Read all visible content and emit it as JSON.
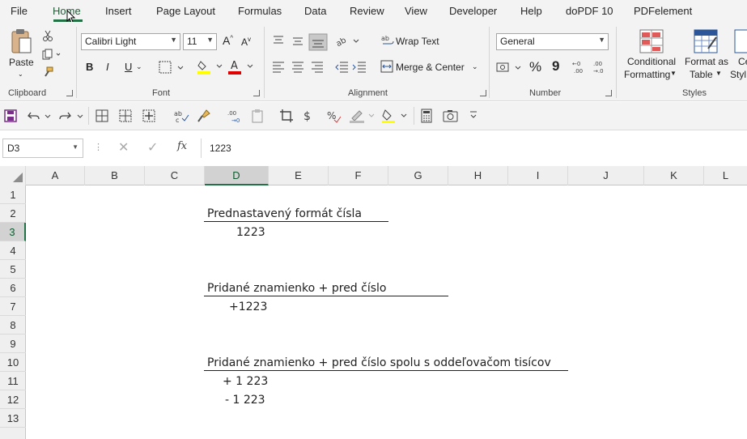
{
  "menu": {
    "tabs": [
      "File",
      "Home",
      "Insert",
      "Page Layout",
      "Formulas",
      "Data",
      "Review",
      "View",
      "Developer",
      "Help",
      "doPDF 10",
      "PDFelement"
    ]
  },
  "ribbon": {
    "clipboard": {
      "paste": "Paste",
      "label": "Clipboard"
    },
    "font": {
      "name": "Calibri Light",
      "size": "11",
      "bold": "B",
      "italic": "I",
      "underline": "U",
      "label": "Font"
    },
    "alignment": {
      "wrap": "Wrap Text",
      "merge": "Merge & Center",
      "label": "Alignment"
    },
    "number": {
      "format": "General",
      "percent": "%",
      "comma": "9",
      "label": "Number"
    },
    "styles": {
      "cond_line1": "Conditional",
      "cond_line2": "Formatting",
      "table_line1": "Format as",
      "table_line2": "Table",
      "cell_line1": "Ce",
      "cell_line2": "Styl",
      "label": "Styles"
    }
  },
  "formula_bar": {
    "name_box": "D3",
    "fx": "fx",
    "value": "1223"
  },
  "columns": [
    "A",
    "B",
    "C",
    "D",
    "E",
    "F",
    "G",
    "H",
    "I",
    "J",
    "K",
    "L"
  ],
  "rows": [
    "1",
    "2",
    "3",
    "4",
    "5",
    "6",
    "7",
    "8",
    "9",
    "10",
    "11",
    "12",
    "13"
  ],
  "cells": {
    "c2": "Prednastavený formát čísla",
    "d3": "1223",
    "c6": "Pridané znamienko + pred číslo",
    "d7": "+1223",
    "c10": "Pridané znamienko + pred číslo spolu s oddeľovačom tisícov",
    "d11": "+ 1 223",
    "d12": "- 1 223"
  },
  "colors": {
    "accent": "#217346",
    "ribbon_bg": "#f3f3f3"
  }
}
